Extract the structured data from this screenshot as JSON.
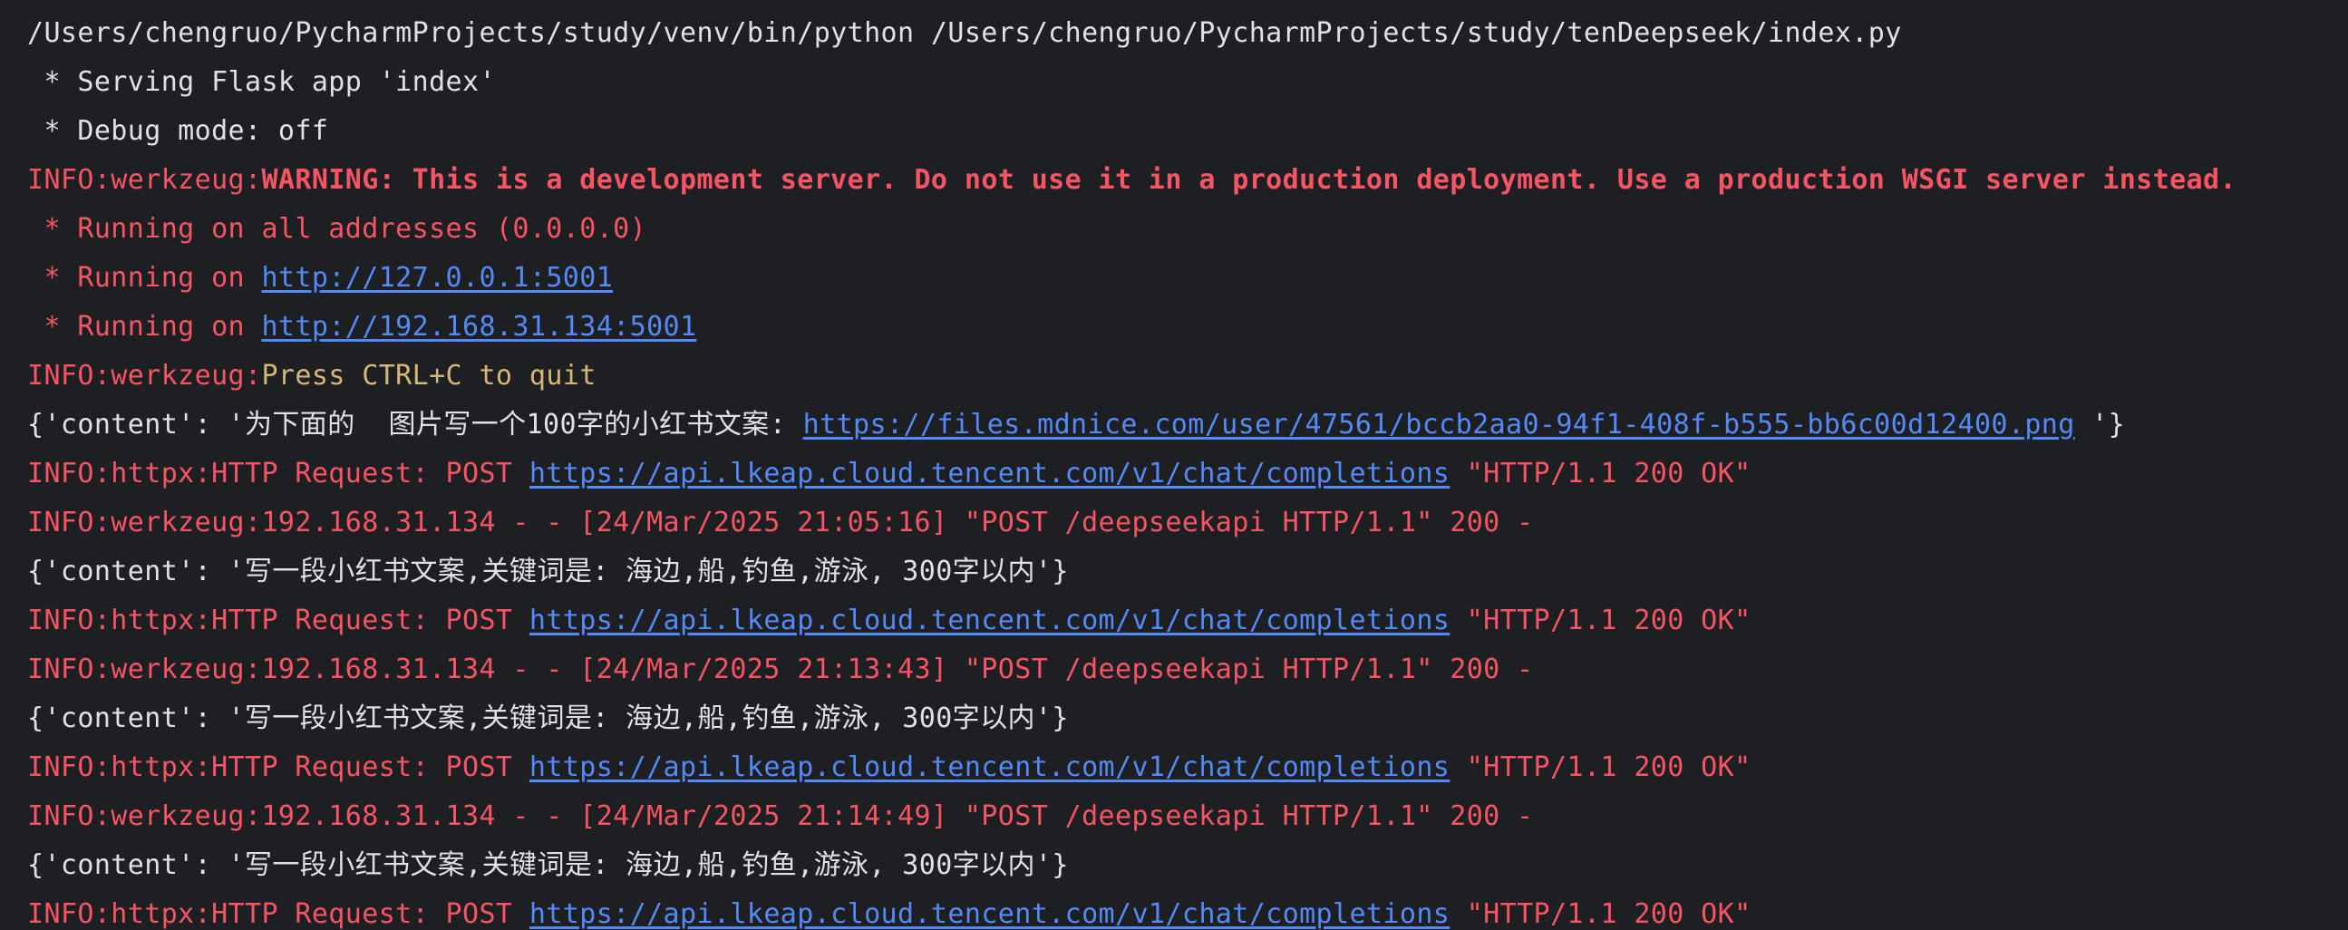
{
  "console": {
    "lines": [
      {
        "parts": [
          {
            "text": "/Users/chengruo/PycharmProjects/study/venv/bin/python /Users/chengruo/PycharmProjects/study/tenDeepseek/index.py",
            "style": "plain"
          }
        ]
      },
      {
        "parts": [
          {
            "text": " * Serving Flask app 'index'",
            "style": "plain"
          }
        ]
      },
      {
        "parts": [
          {
            "text": " * Debug mode: off",
            "style": "plain"
          }
        ]
      },
      {
        "parts": [
          {
            "text": "INFO:werkzeug:",
            "style": "red"
          },
          {
            "text": "WARNING: This is a development server. Do not use it in a production deployment. Use a production WSGI server instead.",
            "style": "warn"
          }
        ]
      },
      {
        "parts": [
          {
            "text": " * Running on all addresses (0.0.0.0)",
            "style": "red"
          }
        ]
      },
      {
        "parts": [
          {
            "text": " * Running on ",
            "style": "red"
          },
          {
            "text": "http://127.0.0.1:5001",
            "style": "link"
          }
        ]
      },
      {
        "parts": [
          {
            "text": " * Running on ",
            "style": "red"
          },
          {
            "text": "http://192.168.31.134:5001",
            "style": "link"
          }
        ]
      },
      {
        "parts": [
          {
            "text": "INFO:werkzeug:",
            "style": "red"
          },
          {
            "text": "Press CTRL+C to quit",
            "style": "yellow"
          }
        ]
      },
      {
        "parts": [
          {
            "text": "{'content': '为下面的  图片写一个100字的小红书文案: ",
            "style": "plain"
          },
          {
            "text": "https://files.mdnice.com/user/47561/bccb2aa0-94f1-408f-b555-bb6c00d12400.png",
            "style": "link"
          },
          {
            "text": " '}",
            "style": "plain"
          }
        ]
      },
      {
        "parts": [
          {
            "text": "INFO:httpx:HTTP Request: POST ",
            "style": "red"
          },
          {
            "text": "https://api.lkeap.cloud.tencent.com/v1/chat/completions",
            "style": "link"
          },
          {
            "text": " \"HTTP/1.1 200 OK\"",
            "style": "red"
          }
        ]
      },
      {
        "parts": [
          {
            "text": "INFO:werkzeug:192.168.31.134 - - [24/Mar/2025 21:05:16] \"POST /deepseekapi HTTP/1.1\" 200 -",
            "style": "red"
          }
        ]
      },
      {
        "parts": [
          {
            "text": "{'content': '写一段小红书文案,关键词是: 海边,船,钓鱼,游泳, 300字以内'}",
            "style": "plain"
          }
        ]
      },
      {
        "parts": [
          {
            "text": "INFO:httpx:HTTP Request: POST ",
            "style": "red"
          },
          {
            "text": "https://api.lkeap.cloud.tencent.com/v1/chat/completions",
            "style": "link"
          },
          {
            "text": " \"HTTP/1.1 200 OK\"",
            "style": "red"
          }
        ]
      },
      {
        "parts": [
          {
            "text": "INFO:werkzeug:192.168.31.134 - - [24/Mar/2025 21:13:43] \"POST /deepseekapi HTTP/1.1\" 200 -",
            "style": "red"
          }
        ]
      },
      {
        "parts": [
          {
            "text": "{'content': '写一段小红书文案,关键词是: 海边,船,钓鱼,游泳, 300字以内'}",
            "style": "plain"
          }
        ]
      },
      {
        "parts": [
          {
            "text": "INFO:httpx:HTTP Request: POST ",
            "style": "red"
          },
          {
            "text": "https://api.lkeap.cloud.tencent.com/v1/chat/completions",
            "style": "link"
          },
          {
            "text": " \"HTTP/1.1 200 OK\"",
            "style": "red"
          }
        ]
      },
      {
        "parts": [
          {
            "text": "INFO:werkzeug:192.168.31.134 - - [24/Mar/2025 21:14:49] \"POST /deepseekapi HTTP/1.1\" 200 -",
            "style": "red"
          }
        ]
      },
      {
        "parts": [
          {
            "text": "{'content': '写一段小红书文案,关键词是: 海边,船,钓鱼,游泳, 300字以内'}",
            "style": "plain"
          }
        ]
      },
      {
        "parts": [
          {
            "text": "INFO:httpx:HTTP Request: POST ",
            "style": "red"
          },
          {
            "text": "https://api.lkeap.cloud.tencent.com/v1/chat/completions",
            "style": "link"
          },
          {
            "text": " \"HTTP/1.1 200 OK\"",
            "style": "red"
          }
        ]
      }
    ]
  },
  "colors": {
    "background": "#1e1f22",
    "plain": "#dfe1e5",
    "error_red": "#f75464",
    "warning_yellow": "#d5b778",
    "link_blue": "#548af7"
  }
}
